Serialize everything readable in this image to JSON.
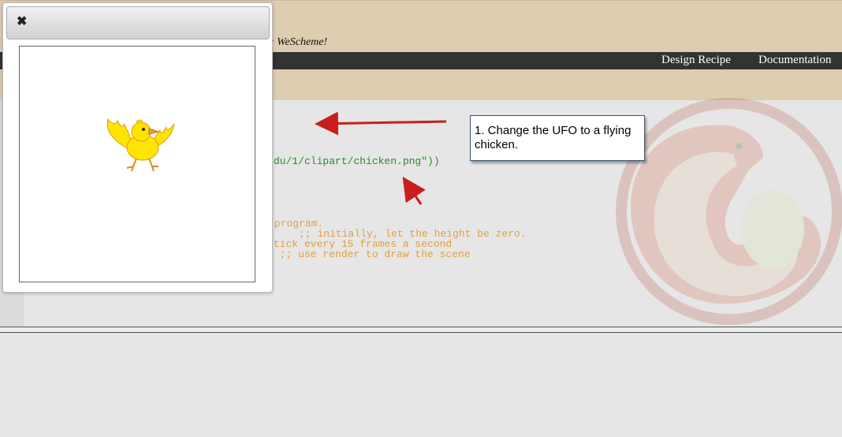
{
  "header": {
    "tagline": "; WeScheme!"
  },
  "nav": {
    "design_recipe": "Design Recipe",
    "documentation": "Documentation"
  },
  "editor": {
    "lines": [
      "du/1/clipart/chicken.png\"))",
      " program.",
      "     ;; initially, let the height be zero.",
      "tick every 15 frames a second",
      " ;; use render to draw the scene"
    ]
  },
  "popup": {
    "close_label": "✖"
  },
  "callout": {
    "text": "1. Change the UFO to a flying chicken."
  },
  "colors": {
    "header_bg": "#dfcdb0",
    "nav_bg": "#333333",
    "arrow": "#c81e1e",
    "code_string": "#2a8a2a",
    "code_comment": "#e0a040"
  },
  "icons": [
    "close-icon",
    "chicken-image",
    "wescheme-logo-watermark"
  ]
}
